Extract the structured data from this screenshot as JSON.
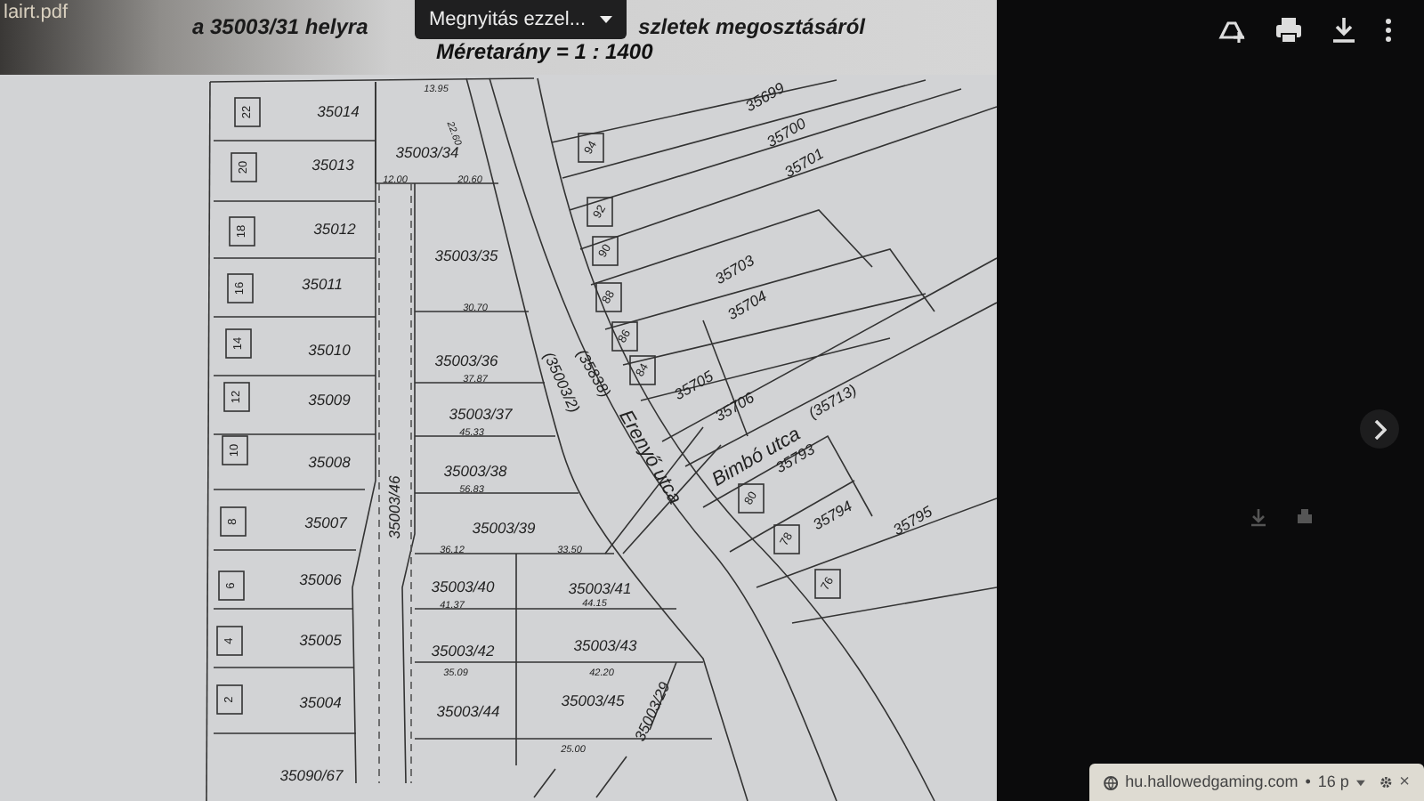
{
  "file_name": "lairt.pdf",
  "open_with": {
    "label": "Megnyitás ezzel..."
  },
  "document": {
    "title_left": "a 35003/31 helyra",
    "title_right": "szletek megosztásáról",
    "scale": "Méretarány = 1 : 1400",
    "map": {
      "labels": [
        {
          "text": "35014",
          "kind": "parcel"
        },
        {
          "text": "35013",
          "kind": "parcel"
        },
        {
          "text": "35012",
          "kind": "parcel"
        },
        {
          "text": "35011",
          "kind": "parcel"
        },
        {
          "text": "35010",
          "kind": "parcel"
        },
        {
          "text": "35009",
          "kind": "parcel"
        },
        {
          "text": "35008",
          "kind": "parcel"
        },
        {
          "text": "35007",
          "kind": "parcel"
        },
        {
          "text": "35006",
          "kind": "parcel"
        },
        {
          "text": "35005",
          "kind": "parcel"
        },
        {
          "text": "35004",
          "kind": "parcel"
        },
        {
          "text": "35090/67",
          "kind": "parcel"
        },
        {
          "text": "35003/34",
          "kind": "parcel"
        },
        {
          "text": "35003/35",
          "kind": "parcel"
        },
        {
          "text": "35003/36",
          "kind": "parcel"
        },
        {
          "text": "35003/37",
          "kind": "parcel"
        },
        {
          "text": "35003/38",
          "kind": "parcel"
        },
        {
          "text": "35003/39",
          "kind": "parcel"
        },
        {
          "text": "35003/40",
          "kind": "parcel"
        },
        {
          "text": "35003/41",
          "kind": "parcel"
        },
        {
          "text": "35003/42",
          "kind": "parcel"
        },
        {
          "text": "35003/43",
          "kind": "parcel"
        },
        {
          "text": "35003/44",
          "kind": "parcel"
        },
        {
          "text": "35003/45",
          "kind": "parcel"
        },
        {
          "text": "35003/46",
          "kind": "parcel"
        },
        {
          "text": "35003/29",
          "kind": "parcel"
        },
        {
          "text": "35699",
          "kind": "parcel"
        },
        {
          "text": "35700",
          "kind": "parcel"
        },
        {
          "text": "35701",
          "kind": "parcel"
        },
        {
          "text": "35703",
          "kind": "parcel"
        },
        {
          "text": "35704",
          "kind": "parcel"
        },
        {
          "text": "35705",
          "kind": "parcel"
        },
        {
          "text": "35706",
          "kind": "parcel"
        },
        {
          "text": "(35713)",
          "kind": "parcel"
        },
        {
          "text": "35793",
          "kind": "parcel"
        },
        {
          "text": "35794",
          "kind": "parcel"
        },
        {
          "text": "35795",
          "kind": "parcel"
        },
        {
          "text": "Erenyő utca",
          "kind": "street"
        },
        {
          "text": "Bimbó utca",
          "kind": "street"
        },
        {
          "text": "(35838)",
          "kind": "parcel"
        },
        {
          "text": "(35003/2)",
          "kind": "parcel"
        },
        {
          "text": "94",
          "kind": "house"
        },
        {
          "text": "92",
          "kind": "house"
        },
        {
          "text": "90",
          "kind": "house"
        },
        {
          "text": "88",
          "kind": "house"
        },
        {
          "text": "86",
          "kind": "house"
        },
        {
          "text": "84",
          "kind": "house"
        },
        {
          "text": "80",
          "kind": "house"
        },
        {
          "text": "78",
          "kind": "house"
        },
        {
          "text": "76",
          "kind": "house"
        },
        {
          "text": "22",
          "kind": "house"
        },
        {
          "text": "20",
          "kind": "house"
        },
        {
          "text": "18",
          "kind": "house"
        },
        {
          "text": "16",
          "kind": "house"
        },
        {
          "text": "14",
          "kind": "house"
        },
        {
          "text": "12",
          "kind": "house"
        },
        {
          "text": "10",
          "kind": "house"
        },
        {
          "text": "8",
          "kind": "house"
        },
        {
          "text": "6",
          "kind": "house"
        },
        {
          "text": "4",
          "kind": "house"
        },
        {
          "text": "2",
          "kind": "house"
        },
        {
          "text": "13.95",
          "kind": "measure"
        },
        {
          "text": "22.60",
          "kind": "measure"
        },
        {
          "text": "12.00",
          "kind": "measure"
        },
        {
          "text": "20.60",
          "kind": "measure"
        },
        {
          "text": "30.70",
          "kind": "measure"
        },
        {
          "text": "37.87",
          "kind": "measure"
        },
        {
          "text": "45.33",
          "kind": "measure"
        },
        {
          "text": "56.83",
          "kind": "measure"
        },
        {
          "text": "36.12",
          "kind": "measure"
        },
        {
          "text": "33.50",
          "kind": "measure"
        },
        {
          "text": "41.37",
          "kind": "measure"
        },
        {
          "text": "44.15",
          "kind": "measure"
        },
        {
          "text": "35.09",
          "kind": "measure"
        },
        {
          "text": "42.20",
          "kind": "measure"
        },
        {
          "text": "25.00",
          "kind": "measure"
        }
      ]
    }
  },
  "notification": {
    "site": "hu.hallowedgaming.com",
    "separator": "•",
    "time": "16 p",
    "close": "×"
  }
}
